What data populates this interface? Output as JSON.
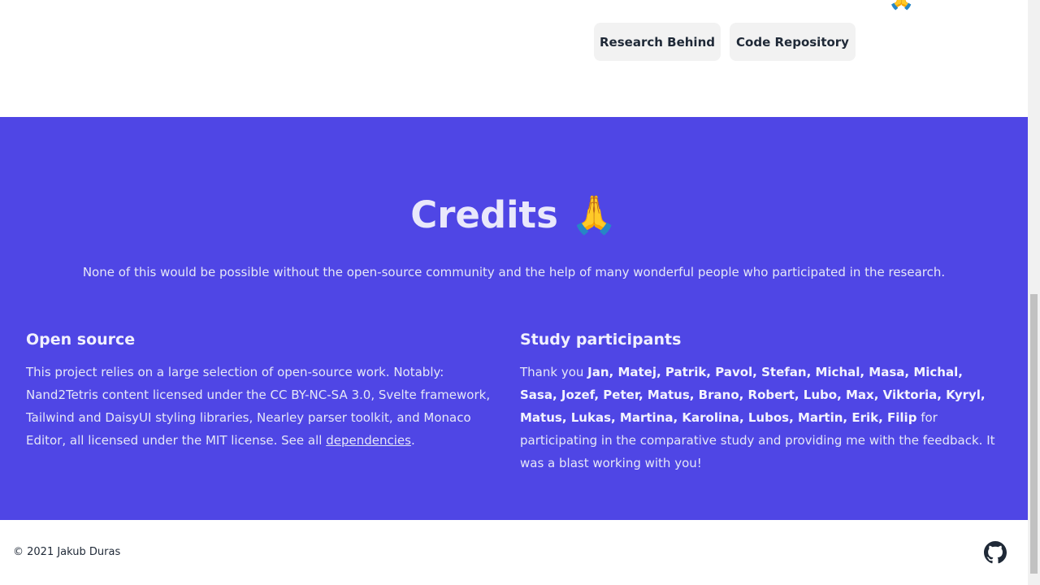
{
  "top": {
    "emoji_peek": "🙏",
    "buttons": [
      {
        "label": "Research Behind"
      },
      {
        "label": "Code Repository"
      }
    ]
  },
  "credits": {
    "title": "Credits",
    "title_emoji": "🙏",
    "subtitle": "None of this would be possible without the open-source community and the help of many wonderful people who participated in the research.",
    "open_source": {
      "heading": "Open source",
      "text_before": "This project relies on a large selection of open-source work. Notably: Nand2Tetris content licensed under the CC BY-NC-SA 3.0, Svelte framework, Tailwind and DaisyUI styling libraries, Nearley parser toolkit, and Monaco Editor, all licensed under the MIT license. See all ",
      "link": "dependencies",
      "text_after": "."
    },
    "participants": {
      "heading": "Study participants",
      "text_before": "Thank you ",
      "names": "Jan, Matej, Patrik, Pavol, Stefan, Michal, Masa, Michal, Sasa, Jozef, Peter, Matus, Brano, Robert, Lubo, Max, Viktoria, Kyryl, Matus, Lukas, Martina, Karolina, Lubos, Martin, Erik, Filip",
      "text_after": " for participating in the comparative study and providing me with the feedback. It was a blast working with you!"
    },
    "bg_color": "#4f46e5"
  },
  "footer": {
    "copyright": "© 2021 Jakub Duras",
    "icon": "github-icon"
  }
}
